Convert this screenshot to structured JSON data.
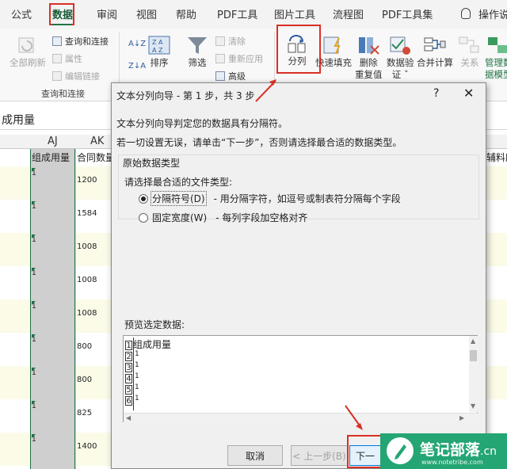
{
  "ribbon_tabs": [
    "公式",
    "数据",
    "审阅",
    "视图",
    "帮助",
    "PDF工具",
    "图片工具",
    "流程图",
    "PDF工具集",
    "操作说"
  ],
  "ribbon": {
    "refresh_all": "全部刷新",
    "queries_connections": "查询和连接",
    "properties": "属性",
    "edit_links": "编辑链接",
    "group_queries": "查询和连接",
    "sort": "排序",
    "filter": "筛选",
    "clear": "清除",
    "reapply": "重新应用",
    "advanced": "高级",
    "text_to_columns": "分列",
    "flash_fill": "快速填充",
    "remove_duplicates_1": "删除",
    "remove_duplicates_2": "重复值",
    "data_validation_1": "数据验",
    "data_validation_2": "证 ˇ",
    "consolidate": "合并计算",
    "relationships": "关系",
    "manage_model_1": "管理数",
    "manage_model_2": "据模型"
  },
  "formula_bar": {
    "content": "成用量"
  },
  "columns": {
    "aj": "AJ",
    "ak": "AK"
  },
  "header_cells": {
    "aj": "组成用量",
    "ak": "合同数量",
    "right": "辅料所"
  },
  "ak_values": [
    "1200",
    "1584",
    "1008",
    "1008",
    "1008",
    "800",
    "800",
    "825",
    "1400"
  ],
  "aj_values": [
    "1",
    "1",
    "1",
    "1",
    "1",
    "1",
    "1",
    "1",
    "1"
  ],
  "dialog": {
    "title": "文本分列向导 - 第 1 步，共 3 步",
    "help": "?",
    "close": "✕",
    "line1": "文本分列向导判定您的数据具有分隔符。",
    "line2": "若一切设置无误，请单击“下一步”，否则请选择最合适的数据类型。",
    "group_title": "原始数据类型",
    "choose_label": "请选择最合适的文件类型:",
    "option1_label": "分隔符号(D)",
    "option1_desc": "- 用分隔字符，如逗号或制表符分隔每个字段",
    "option2_label": "固定宽度(W)",
    "option2_desc": "- 每列字段加空格对齐",
    "preview_label": "预览选定数据:",
    "preview_header": "组成用量",
    "preview_rownums": [
      "1",
      "2",
      "3",
      "4",
      "5",
      "6"
    ],
    "preview_values": [
      "1",
      "1",
      "1",
      "1",
      "1"
    ],
    "cancel": "取消",
    "back": "< 上一步(B)",
    "next": "下一"
  },
  "watermark": {
    "title": "笔记部落",
    "suffix": ".cn",
    "subtitle": "www.notetribe.com"
  }
}
